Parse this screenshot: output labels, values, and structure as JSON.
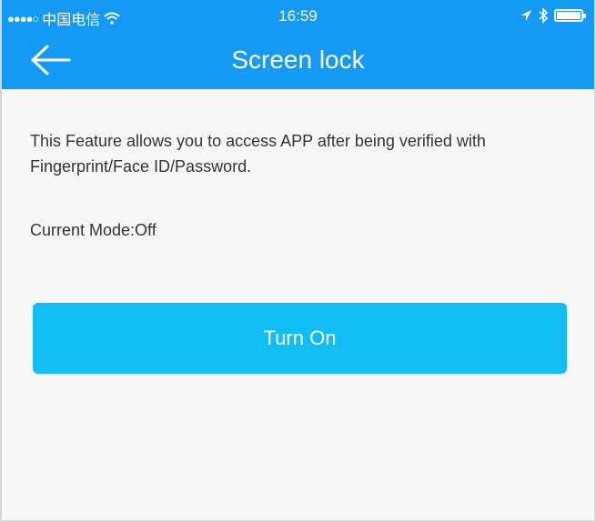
{
  "status_bar": {
    "signal": "●●●●○",
    "carrier": "中国电信",
    "time": "16:59"
  },
  "nav": {
    "title": "Screen lock"
  },
  "content": {
    "description": "This Feature allows you to access APP after being verified with Fingerprint/Face ID/Password.",
    "current_mode": "Current Mode:Off",
    "button_label": "Turn On"
  },
  "colors": {
    "header": "#139af5",
    "button": "#11bdf5",
    "background": "#f7f7f7",
    "text": "#333333"
  },
  "icons": {
    "back": "arrow-left-icon",
    "wifi": "wifi-icon",
    "location": "location-arrow-icon",
    "bluetooth": "bluetooth-icon",
    "battery": "battery-icon"
  }
}
